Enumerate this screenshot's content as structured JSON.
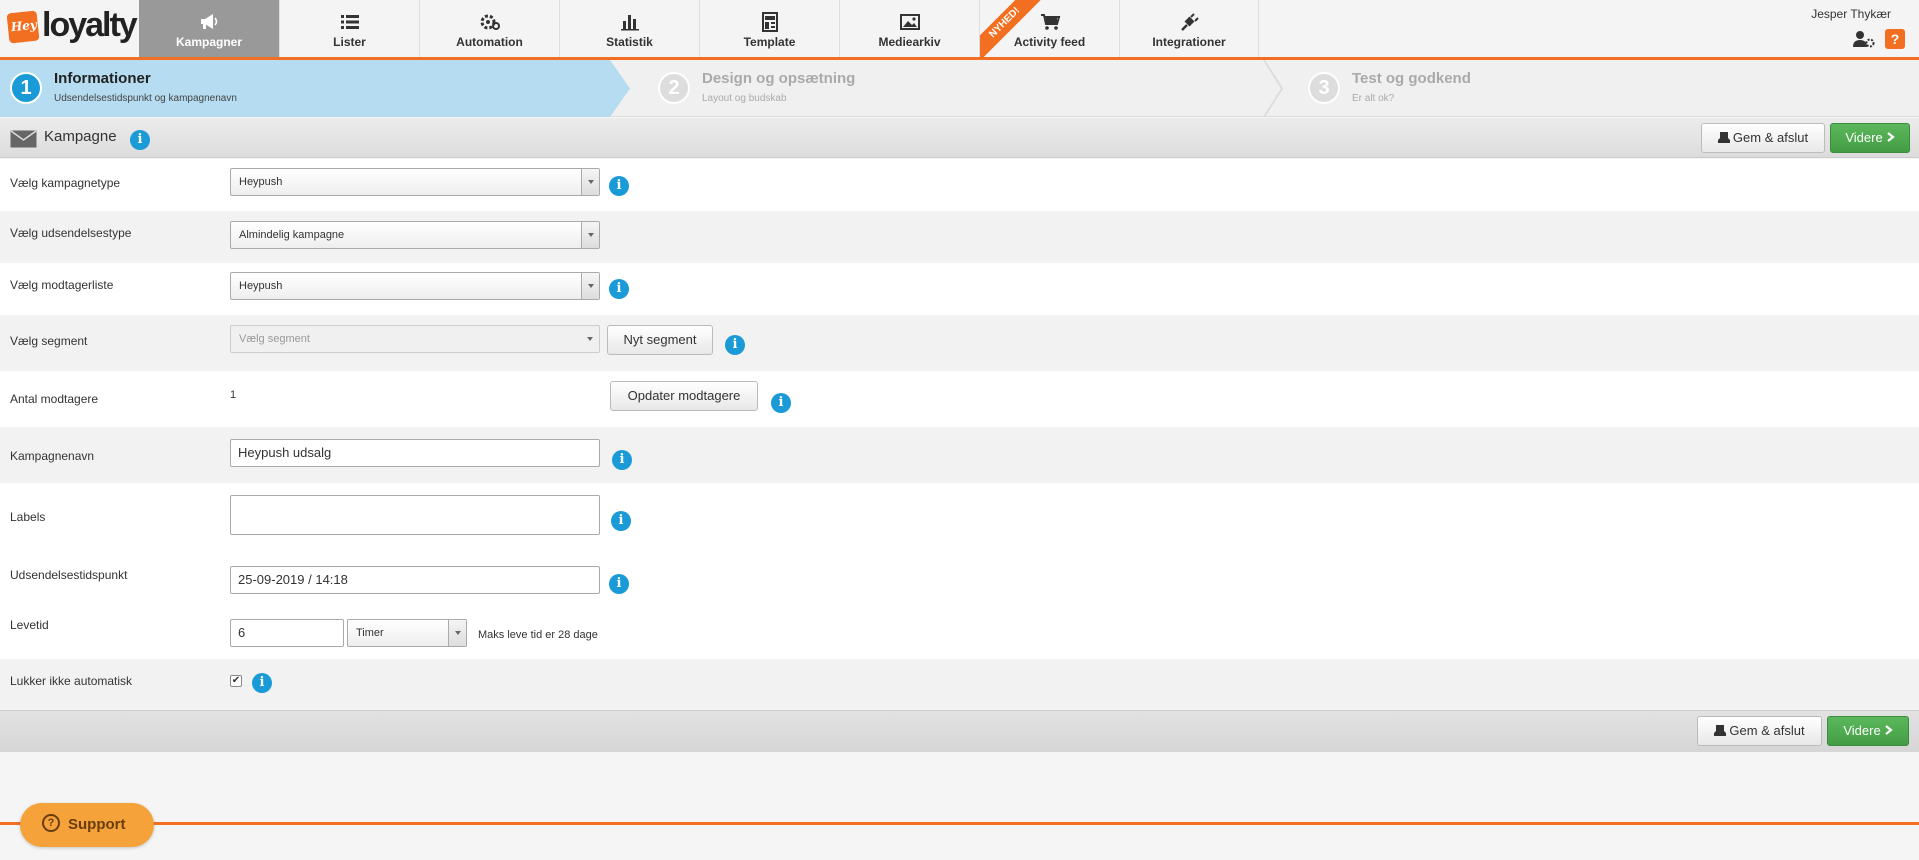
{
  "header": {
    "logo_badge": "Hey",
    "logo_text": "loyalty",
    "user_name": "Jesper Thykær",
    "help_label": "?"
  },
  "nav": [
    {
      "label": "Kampagner",
      "icon": "megaphone-icon",
      "active": true
    },
    {
      "label": "Lister",
      "icon": "list-icon"
    },
    {
      "label": "Automation",
      "icon": "gears-icon"
    },
    {
      "label": "Statistik",
      "icon": "bar-chart-icon"
    },
    {
      "label": "Template",
      "icon": "template-icon"
    },
    {
      "label": "Mediearkiv",
      "icon": "image-icon"
    },
    {
      "label": "Activity feed",
      "icon": "cart-icon",
      "ribbon": "NYHED!"
    },
    {
      "label": "Integrationer",
      "icon": "plug-icon"
    }
  ],
  "steps": [
    {
      "number": "1",
      "title": "Informationer",
      "subtitle": "Udsendelsestidspunkt og kampagnenavn",
      "active": true
    },
    {
      "number": "2",
      "title": "Design og opsætning",
      "subtitle": "Layout og budskab"
    },
    {
      "number": "3",
      "title": "Test og godkend",
      "subtitle": "Er alt ok?"
    }
  ],
  "panel": {
    "title": "Kampagne",
    "save_label": "Gem & afslut",
    "next_label": "Videre"
  },
  "form": {
    "campaign_type": {
      "label": "Vælg kampagnetype",
      "value": "Heypush"
    },
    "send_type": {
      "label": "Vælg udsendelsestype",
      "value": "Almindelig kampagne"
    },
    "recipient_list": {
      "label": "Vælg modtagerliste",
      "value": "Heypush"
    },
    "segment": {
      "label": "Vælg segment",
      "placeholder": "Vælg segment",
      "new_button": "Nyt segment"
    },
    "recipients": {
      "label": "Antal modtagere",
      "value": "1",
      "update_button": "Opdater modtagere"
    },
    "campaign_name": {
      "label": "Kampagnenavn",
      "value": "Heypush udsalg"
    },
    "labels": {
      "label": "Labels",
      "value": ""
    },
    "send_time": {
      "label": "Udsendelsestidspunkt",
      "value": "25-09-2019 / 14:18"
    },
    "lifetime": {
      "label": "Levetid",
      "value": "6",
      "unit": "Timer",
      "hint": "Maks leve tid er 28 dage"
    },
    "auto_close": {
      "label": "Lukker ikke automatisk",
      "checked": true
    }
  },
  "footer": {
    "save_label": "Gem & afslut",
    "next_label": "Videre"
  },
  "support": {
    "label": "Support"
  },
  "colors": {
    "accent": "#f26f21",
    "active_step": "#b5dcf0",
    "info": "#1a9ad6",
    "green": "#5cb85c"
  }
}
